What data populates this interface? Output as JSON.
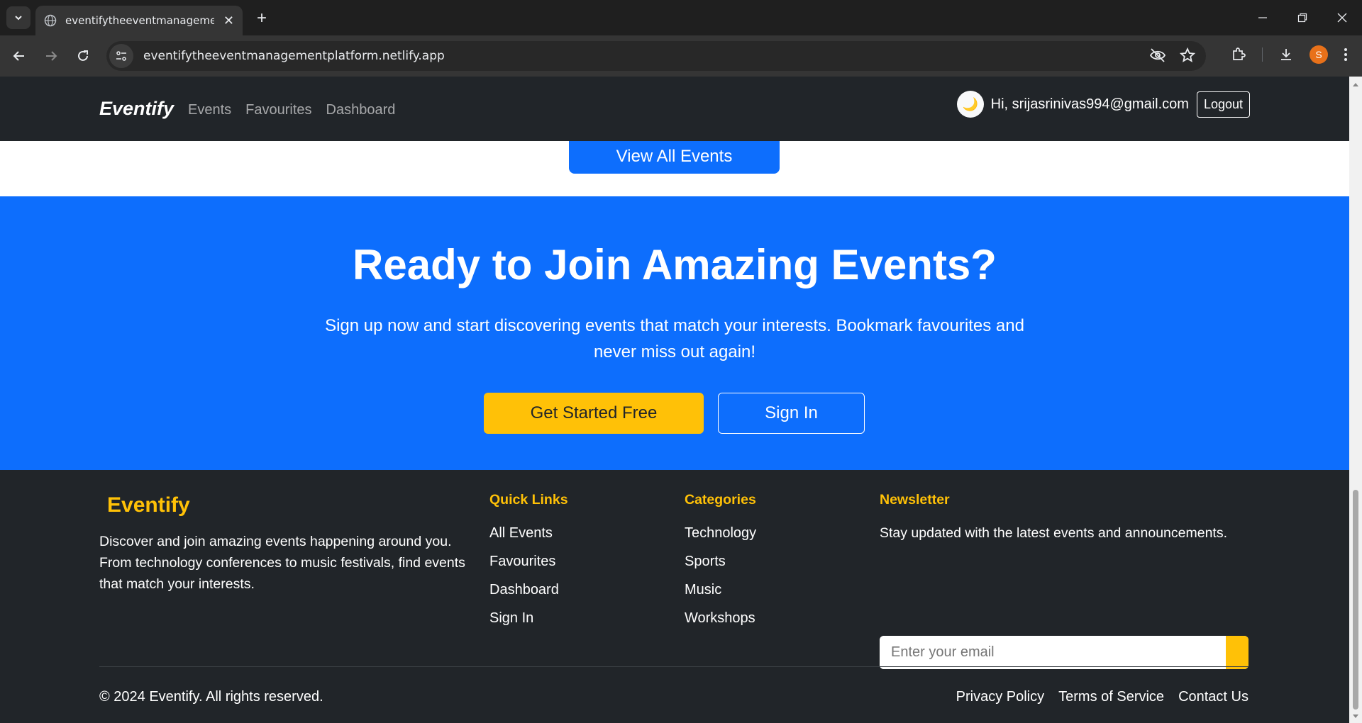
{
  "browser": {
    "tab_title": "eventifytheeventmanagementplatform.netlify.app",
    "url": "eventifytheeventmanagementplatform.netlify.app",
    "profile_initial": "S",
    "tab_close": "✕",
    "new_tab": "+"
  },
  "navbar": {
    "brand": "Eventify",
    "links": [
      "Events",
      "Favourites",
      "Dashboard"
    ],
    "theme_icon": "🌙",
    "greeting": "Hi, srijasrinivas994@gmail.com",
    "logout": "Logout"
  },
  "events_section": {
    "view_all_label": "View All Events"
  },
  "cta": {
    "title": "Ready to Join Amazing Events?",
    "subtitle": "Sign up now and start discovering events that match your interests. Bookmark favourites and never miss out again!",
    "primary_button": "Get Started Free",
    "secondary_button": "Sign In"
  },
  "footer": {
    "brand": "Eventify",
    "description": "Discover and join amazing events happening around you. From technology conferences to music festivals, find events that match your interests.",
    "quick_links": {
      "heading": "Quick Links",
      "items": [
        "All Events",
        "Favourites",
        "Dashboard",
        "Sign In"
      ]
    },
    "categories": {
      "heading": "Categories",
      "items": [
        "Technology",
        "Sports",
        "Music",
        "Workshops"
      ]
    },
    "newsletter": {
      "heading": "Newsletter",
      "text": "Stay updated with the latest events and announcements.",
      "email_placeholder": "Enter your email"
    },
    "copyright": "© 2024 Eventify. All rights reserved.",
    "legal_links": [
      "Privacy Policy",
      "Terms of Service",
      "Contact Us"
    ]
  },
  "colors": {
    "primary": "#0d6efd",
    "accent": "#ffc107",
    "dark": "#212529"
  }
}
